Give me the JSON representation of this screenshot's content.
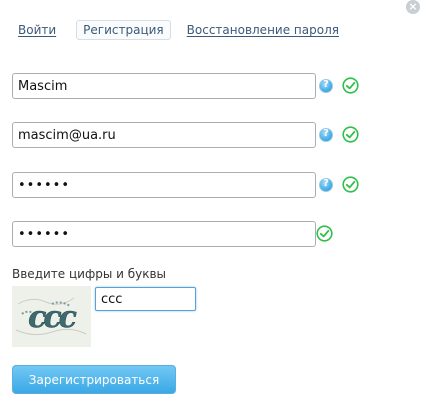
{
  "tabs": {
    "login": "Войти",
    "register": "Регистрация",
    "restore": "Восстановление пароля"
  },
  "form": {
    "username": "Mascim",
    "email": "mascim@ua.ru",
    "password": "••••••",
    "password_confirm": "••••••"
  },
  "captcha": {
    "label": "Введите цифры и буквы",
    "image_text": "ccc",
    "value": "ccc"
  },
  "submit_label": "Зарегистрироваться",
  "colors": {
    "accent": "#3aa8e6",
    "valid": "#2fbf4a",
    "link": "#3a5a7a"
  }
}
